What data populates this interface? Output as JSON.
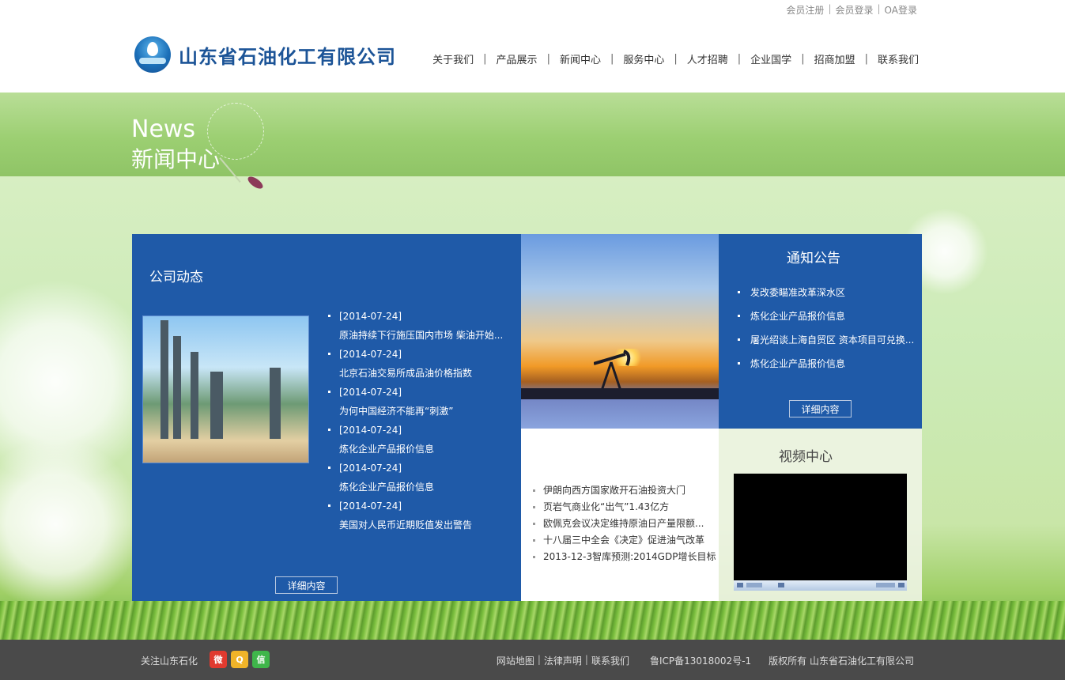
{
  "header": {
    "top_links": [
      "会员注册",
      "会员登录",
      "OA登录"
    ],
    "logo_text": "山东省石油化工有限公司",
    "nav": [
      "关于我们",
      "产品展示",
      "新闻中心",
      "服务中心",
      "人才招聘",
      "企业国学",
      "招商加盟",
      "联系我们"
    ]
  },
  "banner": {
    "en": "News",
    "title": "新闻中心"
  },
  "company_news": {
    "heading": "公司动态",
    "items": [
      {
        "date": "[2014-07-24]",
        "title": "原油持续下行施压国内市场 柴油开始..."
      },
      {
        "date": "[2014-07-24]",
        "title": "北京石油交易所成品油价格指数"
      },
      {
        "date": "[2014-07-24]",
        "title": "为何中国经济不能再“刺激”"
      },
      {
        "date": "[2014-07-24]",
        "title": "炼化企业产品报价信息"
      },
      {
        "date": "[2014-07-24]",
        "title": "炼化企业产品报价信息"
      },
      {
        "date": "[2014-07-24]",
        "title": "美国对人民币近期贬值发出警告"
      }
    ],
    "detail_button": "详细内容"
  },
  "industry_list": [
    "伊朗向西方国家敞开石油投资大门",
    "页岩气商业化“出气”1.43亿方",
    "欧佩克会议决定维持原油日产量限额...",
    "十八届三中全会《决定》促进油气改革",
    "2013-12-3智库预测:2014GDP增长目标"
  ],
  "notice": {
    "heading": "通知公告",
    "items": [
      "发改委瞄准改革深水区",
      "炼化企业产品报价信息",
      "屠光绍谈上海自贸区 资本项目可兑换...",
      "炼化企业产品报价信息"
    ],
    "detail_button": "详细内容"
  },
  "video": {
    "heading": "视频中心"
  },
  "footer": {
    "follow": "关注山东石化",
    "social_icons": [
      "weibo-icon",
      "qzone-icon",
      "wechat-icon"
    ],
    "links": [
      "网站地图",
      "法律声明",
      "联系我们"
    ],
    "icp": "鲁ICP备13018002号-1",
    "copyright": "版权所有 山东省石油化工有限公司"
  },
  "colors": {
    "panel_blue": "#1f5aa8",
    "logo_blue": "#1c5497",
    "footer_bg": "#4a4a4a",
    "banner_green": "#9ccf72"
  }
}
